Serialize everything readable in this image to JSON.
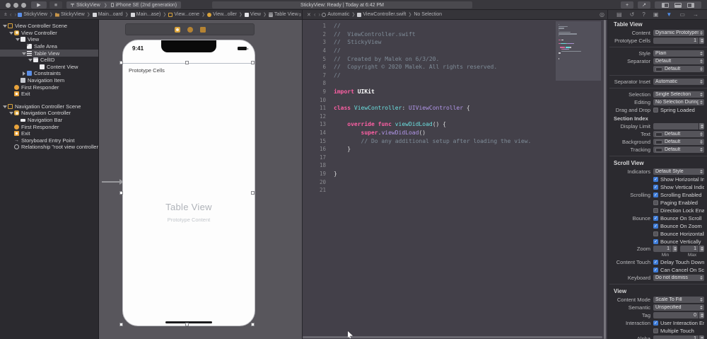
{
  "colors": {
    "accent_blue": "#3E7BD6",
    "icon_yellow": "#D9A33C",
    "keyword_pink": "#FC5FA3"
  },
  "toolbar": {
    "scheme_name": "StickyView",
    "run_destination": "iPhone SE (2nd generation)",
    "status_text": "StickyView: Ready | Today at 6:42 PM",
    "run_glyph": "▶",
    "stop_glyph": "■",
    "add_label": "+",
    "editor_glyph": "↗"
  },
  "jumpbar_left": {
    "back_glyph": "‹",
    "forward_glyph": "›",
    "related_glyph": "±",
    "items": [
      {
        "label": "StickyView",
        "icon": "app-doc"
      },
      {
        "label": "StickyView",
        "icon": "folder"
      },
      {
        "label": "Main...oard",
        "icon": "doc"
      },
      {
        "label": "Main...ase)",
        "icon": "doc"
      },
      {
        "label": "View...cene",
        "icon": "scene"
      },
      {
        "label": "View...oller",
        "icon": "vc"
      },
      {
        "label": "View",
        "icon": "view"
      },
      {
        "label": "Table View",
        "icon": "table"
      }
    ],
    "trailing_glyphs": [
      "⌽",
      "⇥"
    ]
  },
  "jumpbar_right": {
    "close_glyph": "✕",
    "back_glyph": "‹",
    "forward_glyph": "›",
    "items": [
      {
        "label": "Automatic",
        "icon": "auto"
      },
      {
        "label": "ViewController.swift",
        "icon": "swift-doc"
      },
      {
        "label": "No Selection",
        "icon": null
      }
    ],
    "trailing_glyph": "◎"
  },
  "navigator": {
    "items": [
      {
        "depth": 0,
        "disclosure": "open",
        "icon": "scene",
        "label": "View Controller Scene"
      },
      {
        "depth": 1,
        "disclosure": "open",
        "icon": "view-controller",
        "label": "View Controller"
      },
      {
        "depth": 2,
        "disclosure": "open",
        "icon": "view",
        "label": "View"
      },
      {
        "depth": 3,
        "disclosure": null,
        "icon": "safe-area",
        "label": "Safe Area"
      },
      {
        "depth": 3,
        "disclosure": "open",
        "icon": "table-view",
        "label": "Table View",
        "selected": true
      },
      {
        "depth": 4,
        "disclosure": "open",
        "icon": "cell",
        "label": "CellID"
      },
      {
        "depth": 5,
        "disclosure": null,
        "icon": "view",
        "label": "Content View"
      },
      {
        "depth": 3,
        "disclosure": "closed",
        "icon": "constraints",
        "label": "Constraints"
      },
      {
        "depth": 2,
        "disclosure": null,
        "icon": "navigation-item",
        "label": "Navigation Item"
      },
      {
        "depth": 1,
        "disclosure": null,
        "icon": "first-responder",
        "label": "First Responder"
      },
      {
        "depth": 1,
        "disclosure": null,
        "icon": "exit",
        "label": "Exit"
      },
      {
        "gap": true
      },
      {
        "depth": 0,
        "disclosure": "open",
        "icon": "scene",
        "label": "Navigation Controller Scene"
      },
      {
        "depth": 1,
        "disclosure": "open",
        "icon": "view-controller",
        "label": "Navigation Controller"
      },
      {
        "depth": 2,
        "disclosure": null,
        "icon": "navigation-bar",
        "label": "Navigation Bar"
      },
      {
        "depth": 1,
        "disclosure": null,
        "icon": "first-responder",
        "label": "First Responder"
      },
      {
        "depth": 1,
        "disclosure": null,
        "icon": "exit",
        "label": "Exit"
      },
      {
        "depth": 1,
        "disclosure": null,
        "icon": "entry-point",
        "label": "Storyboard Entry Point"
      },
      {
        "depth": 1,
        "disclosure": null,
        "icon": "relationship",
        "label": "Relationship \"root view controller\"..."
      }
    ]
  },
  "canvas": {
    "status_time": "9:41",
    "table_header": "Prototype Cells",
    "placeholder_title": "Table View",
    "placeholder_subtitle": "Prototype Content"
  },
  "editor": {
    "lines": [
      {
        "n": 1,
        "segs": [
          [
            "//",
            "c"
          ]
        ]
      },
      {
        "n": 2,
        "segs": [
          [
            "//  ViewController.swift",
            "c"
          ]
        ]
      },
      {
        "n": 3,
        "segs": [
          [
            "//  StickyView",
            "c"
          ]
        ]
      },
      {
        "n": 4,
        "segs": [
          [
            "//",
            "c"
          ]
        ]
      },
      {
        "n": 5,
        "segs": [
          [
            "//  Created by Malek on 6/3/20.",
            "c"
          ]
        ]
      },
      {
        "n": 6,
        "segs": [
          [
            "//  Copyright © 2020 Malek. All rights reserved.",
            "c"
          ]
        ]
      },
      {
        "n": 7,
        "segs": [
          [
            "//",
            "c"
          ]
        ]
      },
      {
        "n": 8,
        "segs": []
      },
      {
        "n": 9,
        "segs": [
          [
            "import",
            "k"
          ],
          [
            " ",
            "p"
          ],
          [
            "UIKit",
            "b"
          ]
        ]
      },
      {
        "n": 10,
        "segs": []
      },
      {
        "n": 11,
        "segs": [
          [
            "class",
            "k"
          ],
          [
            " ",
            "p"
          ],
          [
            "ViewController",
            "t"
          ],
          [
            ": ",
            "p"
          ],
          [
            "UIViewController",
            "s"
          ],
          [
            " {",
            "p"
          ]
        ]
      },
      {
        "n": 12,
        "segs": []
      },
      {
        "n": 13,
        "segs": [
          [
            "    ",
            "p"
          ],
          [
            "override",
            "k"
          ],
          [
            " ",
            "p"
          ],
          [
            "func",
            "k"
          ],
          [
            " ",
            "p"
          ],
          [
            "viewDidLoad",
            "t"
          ],
          [
            "() {",
            "p"
          ]
        ]
      },
      {
        "n": 14,
        "segs": [
          [
            "        ",
            "p"
          ],
          [
            "super",
            "k"
          ],
          [
            ".",
            "p"
          ],
          [
            "viewDidLoad",
            "s"
          ],
          [
            "()",
            "p"
          ]
        ]
      },
      {
        "n": 15,
        "segs": [
          [
            "        ",
            "p"
          ],
          [
            "// Do any additional setup after loading the view.",
            "c"
          ]
        ]
      },
      {
        "n": 16,
        "segs": [
          [
            "    }",
            "p"
          ]
        ]
      },
      {
        "n": 17,
        "segs": []
      },
      {
        "n": 18,
        "segs": []
      },
      {
        "n": 19,
        "segs": [
          [
            "}",
            "p"
          ]
        ]
      },
      {
        "n": 20,
        "segs": []
      },
      {
        "n": 21,
        "segs": []
      }
    ]
  },
  "inspector": {
    "tabs": [
      "file",
      "history",
      "quick-help",
      "identity",
      "attributes",
      "size",
      "connections"
    ],
    "active_tab": "attributes",
    "sections": [
      {
        "header": "Table View",
        "rows": [
          {
            "kind": "dropdown",
            "label": "Content",
            "value": "Dynamic Prototypes"
          },
          {
            "kind": "stepper",
            "label": "Prototype Cells",
            "value": "1"
          },
          {
            "kind": "divider"
          },
          {
            "kind": "dropdown",
            "label": "Style",
            "value": "Plain"
          },
          {
            "kind": "dropdown",
            "label": "Separator",
            "value": "Default"
          },
          {
            "kind": "color",
            "label": "",
            "value": "Default"
          },
          {
            "kind": "divider"
          },
          {
            "kind": "dropdown",
            "label": "Separator Inset",
            "value": "Automatic"
          },
          {
            "kind": "divider"
          },
          {
            "kind": "dropdown",
            "label": "Selection",
            "value": "Single Selection"
          },
          {
            "kind": "dropdown",
            "label": "Editing",
            "value": "No Selection During Ed..."
          },
          {
            "kind": "check",
            "label": "Drag and Drop",
            "text": "Spring Loaded",
            "checked": false
          },
          {
            "kind": "subheader",
            "label": "Section Index"
          },
          {
            "kind": "stepper",
            "label": "Display Limit",
            "value": ""
          },
          {
            "kind": "color",
            "label": "Text",
            "value": "Default"
          },
          {
            "kind": "color",
            "label": "Background",
            "value": "Default"
          },
          {
            "kind": "color",
            "label": "Tracking",
            "value": "Default"
          },
          {
            "kind": "divider"
          }
        ]
      },
      {
        "header": "Scroll View",
        "rows": [
          {
            "kind": "dropdown",
            "label": "Indicators",
            "value": "Default Style"
          },
          {
            "kind": "check",
            "label": "",
            "text": "Show Horizontal Indicator",
            "checked": true
          },
          {
            "kind": "check",
            "label": "",
            "text": "Show Vertical Indicator",
            "checked": true
          },
          {
            "kind": "check",
            "label": "Scrolling",
            "text": "Scrolling Enabled",
            "checked": true
          },
          {
            "kind": "check",
            "label": "",
            "text": "Paging Enabled",
            "checked": false
          },
          {
            "kind": "check",
            "label": "",
            "text": "Direction Lock Enabled",
            "checked": false
          },
          {
            "kind": "check",
            "label": "Bounce",
            "text": "Bounce On Scroll",
            "checked": true
          },
          {
            "kind": "check",
            "label": "",
            "text": "Bounce On Zoom",
            "checked": true
          },
          {
            "kind": "check",
            "label": "",
            "text": "Bounce Horizontally",
            "checked": false
          },
          {
            "kind": "check",
            "label": "",
            "text": "Bounce Vertically",
            "checked": true
          },
          {
            "kind": "zoom",
            "label": "Zoom",
            "min_value": "1",
            "max_value": "1",
            "min_label": "Min",
            "max_label": "Max"
          },
          {
            "kind": "check",
            "label": "Content Touch",
            "text": "Delay Touch Down",
            "checked": true
          },
          {
            "kind": "check",
            "label": "",
            "text": "Can Cancel On Scroll",
            "checked": true
          },
          {
            "kind": "dropdown",
            "label": "Keyboard",
            "value": "Do not dismiss"
          },
          {
            "kind": "divider"
          }
        ]
      },
      {
        "header": "View",
        "rows": [
          {
            "kind": "dropdown",
            "label": "Content Mode",
            "value": "Scale To Fill"
          },
          {
            "kind": "dropdown",
            "label": "Semantic",
            "value": "Unspecified"
          },
          {
            "kind": "stepper",
            "label": "Tag",
            "value": "0"
          },
          {
            "kind": "check",
            "label": "Interaction",
            "text": "User Interaction Enabled",
            "checked": true
          },
          {
            "kind": "check",
            "label": "",
            "text": "Multiple Touch",
            "checked": false
          },
          {
            "kind": "stepper",
            "label": "Alpha",
            "value": "1"
          }
        ]
      }
    ]
  }
}
